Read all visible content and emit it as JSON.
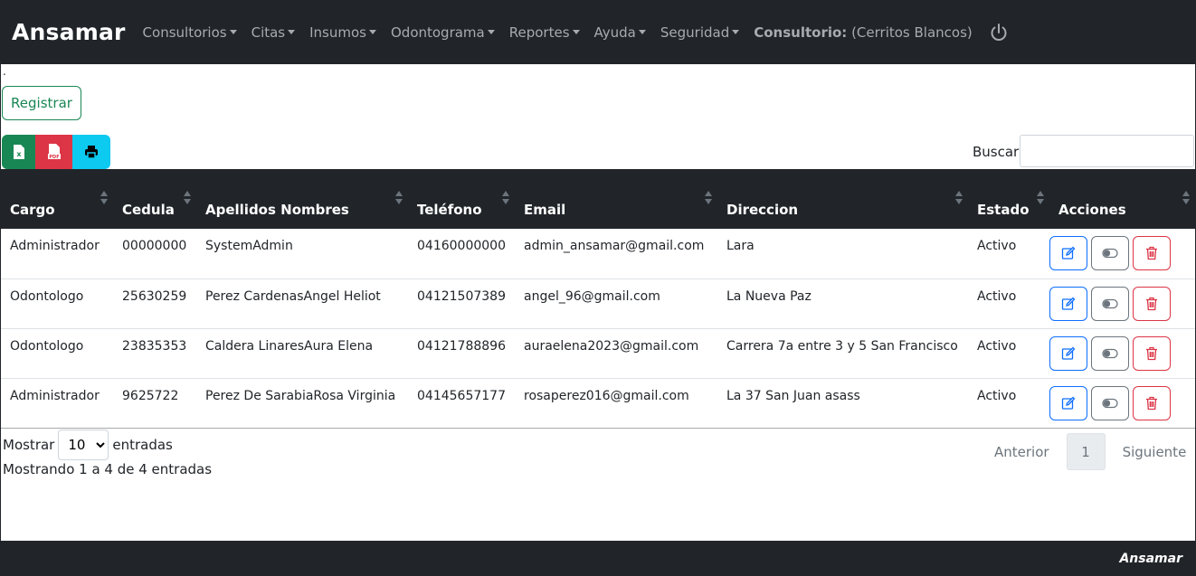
{
  "navbar": {
    "brand": "Ansamar",
    "menus": [
      {
        "label": "Consultorios"
      },
      {
        "label": "Citas"
      },
      {
        "label": "Insumos"
      },
      {
        "label": "Odontograma"
      },
      {
        "label": "Reportes"
      },
      {
        "label": "Ayuda"
      },
      {
        "label": "Seguridad"
      }
    ],
    "consultorio_label": "Consultorio:",
    "consultorio_value": "(Cerritos Blancos)",
    "power_icon": "power-icon"
  },
  "main": {
    "dot": ".",
    "register_label": "Registrar",
    "export_buttons": [
      {
        "icon": "excel-icon",
        "color": "#198754"
      },
      {
        "icon": "pdf-icon",
        "color": "#dc3545"
      },
      {
        "icon": "print-icon",
        "color": "#0dcaf0"
      }
    ],
    "search": {
      "label": "Buscar:",
      "value": "",
      "placeholder": ""
    }
  },
  "table": {
    "columns": [
      "Cargo",
      "Cedula",
      "Apellidos Nombres",
      "Teléfono",
      "Email",
      "Direccion",
      "Estado",
      "Acciones"
    ],
    "rows": [
      {
        "cargo": "Administrador",
        "cedula": "00000000",
        "nombres": "SystemAdmin",
        "telefono": "04160000000",
        "email": "admin_ansamar@gmail.com",
        "direccion": "Lara",
        "estado": "Activo"
      },
      {
        "cargo": "Odontologo",
        "cedula": "25630259",
        "nombres": "Perez CardenasAngel Heliot",
        "telefono": "04121507389",
        "email": "angel_96@gmail.com",
        "direccion": "La Nueva Paz",
        "estado": "Activo"
      },
      {
        "cargo": "Odontologo",
        "cedula": "23835353",
        "nombres": "Caldera LinaresAura Elena",
        "telefono": "04121788896",
        "email": "auraelena2023@gmail.com",
        "direccion": "Carrera 7a entre 3 y 5 San Francisco",
        "estado": "Activo"
      },
      {
        "cargo": "Administrador",
        "cedula": "9625722",
        "nombres": "Perez De SarabiaRosa Virginia",
        "telefono": "04145657177",
        "email": "rosaperez016@gmail.com",
        "direccion": "La 37 San Juan asass",
        "estado": "Activo"
      }
    ]
  },
  "pagination": {
    "show_label": "Mostrar",
    "page_size": "10",
    "entries_label": "entradas",
    "info": "Mostrando 1 a 4 de 4 entradas",
    "prev": "Anterior",
    "current_page": "1",
    "next": "Siguiente"
  },
  "footer": {
    "brand": "Ansamar"
  },
  "colors": {
    "dark": "#212529",
    "success": "#198754",
    "danger": "#dc3545",
    "info": "#0dcaf0",
    "primary": "#0d6efd"
  }
}
